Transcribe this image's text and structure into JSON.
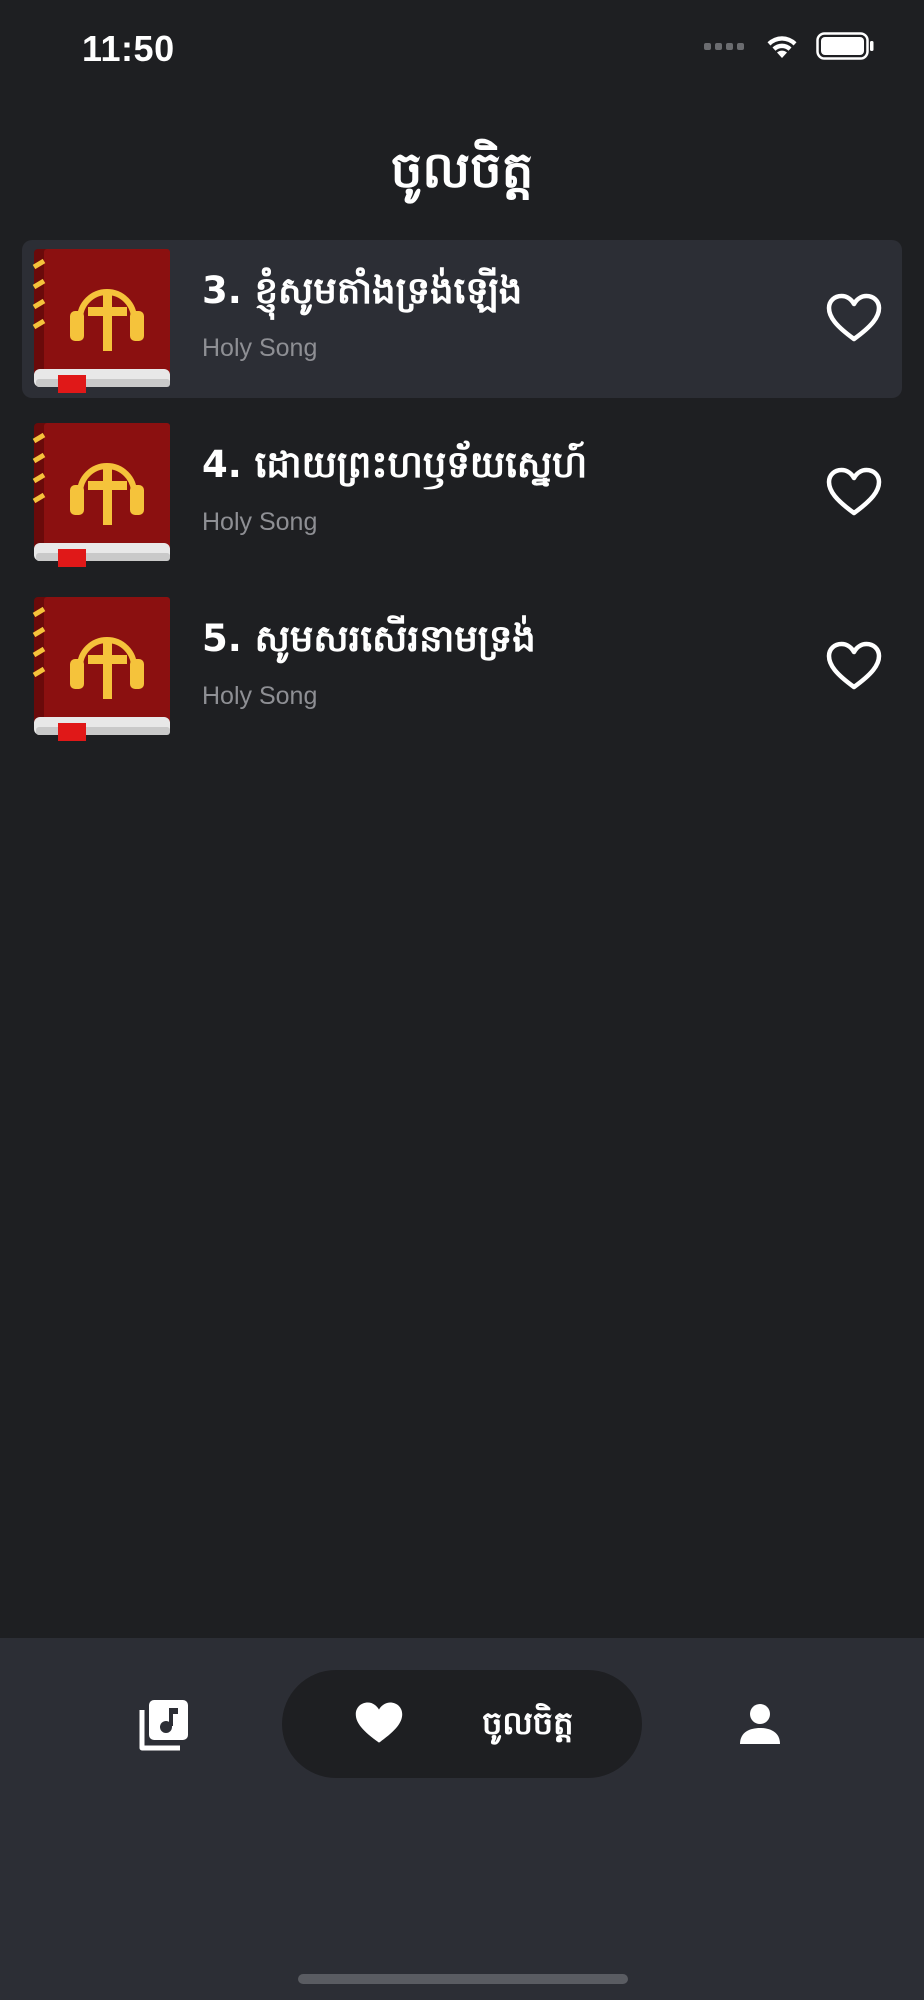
{
  "status_bar": {
    "time": "11:50"
  },
  "header": {
    "title": "ចូលចិត្ត"
  },
  "songs": [
    {
      "title": "3. ខ្ញុំសូមតាំងទ្រង់ឡើង",
      "subtitle": "Holy Song",
      "selected": true
    },
    {
      "title": "4. ដោយព្រះហឫទ័យស្នេហ៍",
      "subtitle": "Holy Song",
      "selected": false
    },
    {
      "title": "5. សូមសរសើរនាមទ្រង់",
      "subtitle": "Holy Song",
      "selected": false
    }
  ],
  "tab_bar": {
    "active_label": "ចូលចិត្ត",
    "tabs": [
      {
        "icon": "music-library-icon"
      },
      {
        "icon": "heart-icon"
      },
      {
        "icon": "person-icon"
      }
    ]
  },
  "colors": {
    "background": "#1e1f22",
    "surface": "#2c2e35",
    "text_primary": "#ffffff",
    "text_secondary": "#8e8f94",
    "book_red": "#8b1010",
    "book_gold": "#f5c33b"
  }
}
